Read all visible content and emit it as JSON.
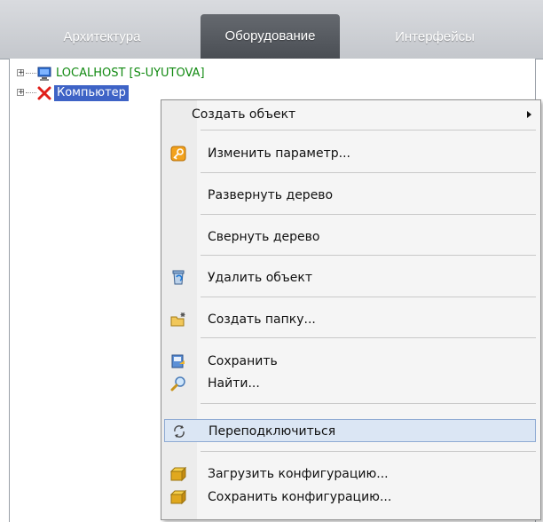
{
  "tabs": [
    {
      "label": "Архитектура",
      "active": false
    },
    {
      "label": "Оборудование",
      "active": true
    },
    {
      "label": "Интерфейсы",
      "active": false
    }
  ],
  "tree": {
    "nodes": [
      {
        "expander": "+",
        "icon": "monitor-icon",
        "label": "LOCALHOST [S-UYUTOVA]"
      },
      {
        "expander": "+",
        "icon": "red-cross-icon",
        "label": "Компьютер "
      }
    ]
  },
  "context_menu": {
    "items": [
      {
        "label": "Создать объект",
        "submenu": true
      },
      {
        "label": "Изменить параметр...",
        "icon": "key-icon"
      },
      {
        "label": "Развернуть дерево"
      },
      {
        "label": "Свернуть дерево"
      },
      {
        "label": "Удалить объект",
        "icon": "recycle-bin-icon"
      },
      {
        "label": "Создать папку...",
        "icon": "new-folder-icon"
      },
      {
        "label": "Сохранить",
        "icon": "save-icon"
      },
      {
        "label": "Найти...",
        "icon": "magnifier-icon"
      },
      {
        "label": "Переподключиться",
        "icon": "reconnect-icon",
        "highlighted": true
      },
      {
        "label": "Загрузить конфигурацию...",
        "icon": "load-config-icon"
      },
      {
        "label": "Сохранить конфигурацию...",
        "icon": "save-config-icon"
      }
    ]
  },
  "colors": {
    "selection": "#3e63c6",
    "node_text_green": "#128a12",
    "menu_highlight": "#dbe6f4",
    "active_tab": "#55595f"
  }
}
